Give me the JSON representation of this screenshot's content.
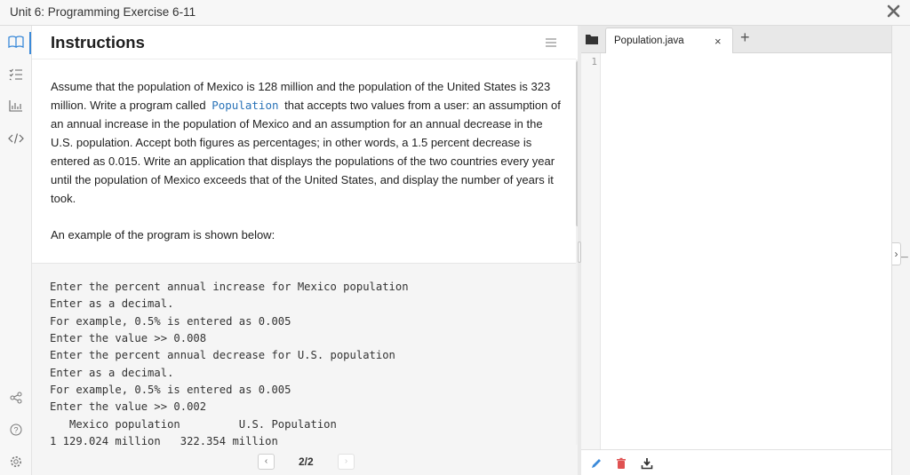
{
  "window": {
    "title": "Unit 6: Programming Exercise 6-11"
  },
  "rail": {
    "icons": [
      "book-icon",
      "checklist-icon",
      "chart-icon",
      "code-icon",
      "share-icon",
      "help-icon",
      "settings-icon"
    ]
  },
  "instructions": {
    "heading": "Instructions",
    "para_pre": "Assume that the population of Mexico is 128 million and the population of the United States is 323 million. Write a program called",
    "class_name": "Population",
    "para_post": "that accepts two values from a user: an assumption of an annual increase in the population of Mexico and an assumption for an annual decrease in the U.S. population. Accept both figures as percentages; in other words, a 1.5 percent decrease is entered as 0.015. Write an application that displays the populations of the two countries every year until the population of Mexico exceeds that of the United States, and display the number of years it took.",
    "example_intro": "An example of the program is shown below:",
    "example_lines": [
      "Enter the percent annual increase for Mexico population",
      "Enter as a decimal.",
      "For example, 0.5% is entered as 0.005",
      "Enter the value >> 0.008",
      "Enter the percent annual decrease for U.S. population",
      "Enter as a decimal.",
      "For example, 0.5% is entered as 0.005",
      "Enter the value >> 0.002",
      "   Mexico population         U.S. Population",
      "1 129.024 million   322.354 million"
    ]
  },
  "pager": {
    "prev": "‹",
    "page": "2/2",
    "next": "›"
  },
  "editor": {
    "tab_name": "Population.java",
    "close": "×",
    "add": "+",
    "line_numbers": [
      "1"
    ]
  },
  "console": {
    "expand": "›",
    "prompt": "_"
  },
  "colors": {
    "accent": "#3b8ad9",
    "link": "#2a73b8",
    "delete": "#e05252",
    "edit": "#3b8ad9"
  }
}
